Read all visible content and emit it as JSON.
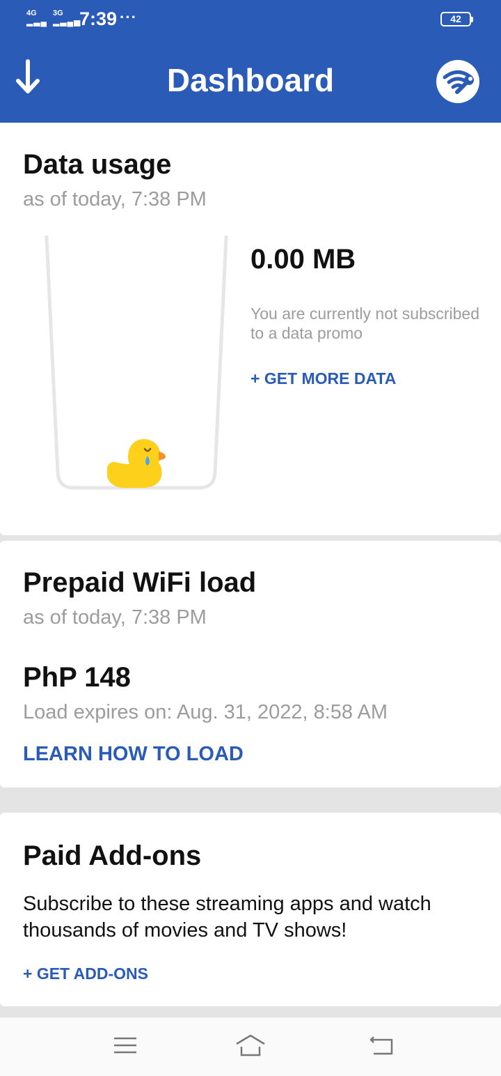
{
  "status_bar": {
    "network1": "4G",
    "network2": "3G",
    "time": "7:39",
    "more": "···",
    "battery": "42"
  },
  "header": {
    "title": "Dashboard",
    "left_icon": "download-arrow-icon",
    "right_icon": "wifi-settings-icon",
    "color": "#2a5bb6"
  },
  "data_usage": {
    "title": "Data usage",
    "as_of": "as of today, 7:38 PM",
    "amount": "0.00 MB",
    "message": "You are currently not subscribed to a data promo",
    "get_more_label": "+ GET MORE DATA",
    "illustration_icon": "crying-duck-in-empty-cup-icon"
  },
  "wifi_load": {
    "title": "Prepaid WiFi load",
    "as_of": "as of today, 7:38 PM",
    "balance": "PhP 148",
    "expiry": "Load expires on: Aug. 31, 2022, 8:58 AM",
    "learn_label": "LEARN HOW TO LOAD"
  },
  "addons": {
    "title": "Paid Add-ons",
    "description": "Subscribe to these streaming apps and watch thousands of movies and TV shows!",
    "get_label": "+ GET ADD-ONS"
  },
  "nav": {
    "menu_icon": "menu-icon",
    "home_icon": "home-icon",
    "back_icon": "back-icon"
  }
}
